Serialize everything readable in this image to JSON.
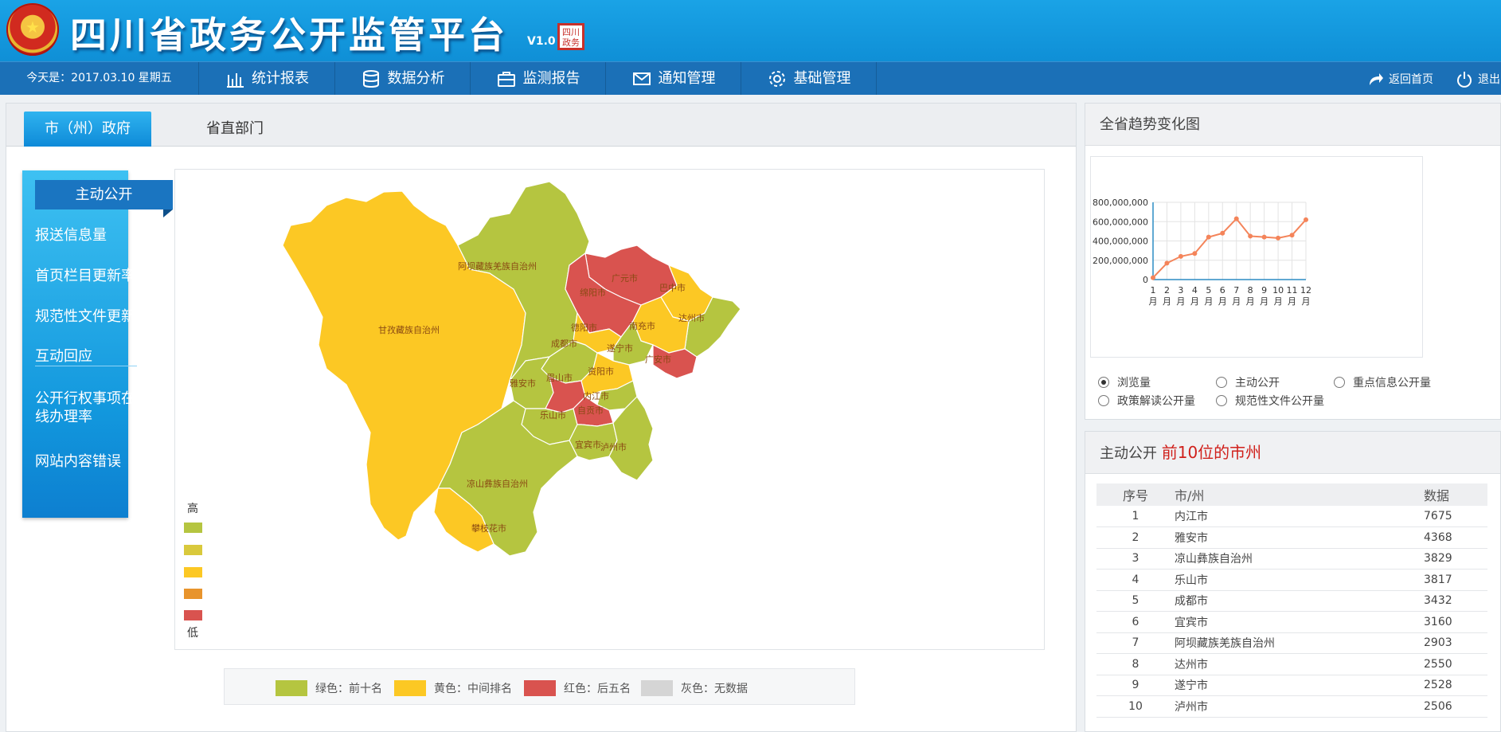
{
  "header": {
    "emblem_glyph": "★",
    "title": "四川省政务公开监管平台",
    "version": "V1.0",
    "seal_text": "四川政务"
  },
  "nav": {
    "date_text": "今天是：2017.03.10  星期五",
    "items": [
      {
        "label": "统计报表",
        "icon": "bar-chart-icon"
      },
      {
        "label": "数据分析",
        "icon": "database-icon"
      },
      {
        "label": "监测报告",
        "icon": "briefcase-icon"
      },
      {
        "label": "通知管理",
        "icon": "envelope-icon"
      },
      {
        "label": "基础管理",
        "icon": "gear-icon"
      }
    ],
    "home_label": "返回首页",
    "logout_label": "退出"
  },
  "tabs": {
    "active": "市（州）政府",
    "other": "省直部门"
  },
  "side_menu": {
    "head": "主动公开",
    "items": [
      "报送信息量",
      "首页栏目更新率",
      "规范性文件更新",
      "互动回应",
      "公开行权事项在线办理率",
      "网站内容错误"
    ]
  },
  "map": {
    "regions": [
      {
        "name": "甘孜藏族自治州",
        "level": "yellow"
      },
      {
        "name": "阿坝藏族羌族自治州",
        "level": "green"
      },
      {
        "name": "广元市",
        "level": "red"
      },
      {
        "name": "绵阳市",
        "level": "red"
      },
      {
        "name": "巴中市",
        "level": "yellow"
      },
      {
        "name": "达州市",
        "level": "green"
      },
      {
        "name": "南充市",
        "level": "yellow"
      },
      {
        "name": "德阳市",
        "level": "yellow"
      },
      {
        "name": "成都市",
        "level": "green"
      },
      {
        "name": "遂宁市",
        "level": "green"
      },
      {
        "name": "广安市",
        "level": "red"
      },
      {
        "name": "雅安市",
        "level": "green"
      },
      {
        "name": "眉山市",
        "level": "red"
      },
      {
        "name": "资阳市",
        "level": "yellow"
      },
      {
        "name": "内江市",
        "level": "green"
      },
      {
        "name": "乐山市",
        "level": "green"
      },
      {
        "name": "自贡市",
        "level": "red"
      },
      {
        "name": "宜宾市",
        "level": "green"
      },
      {
        "name": "泸州市",
        "level": "green"
      },
      {
        "name": "凉山彝族自治州",
        "level": "green"
      },
      {
        "name": "攀枝花市",
        "level": "yellow"
      }
    ],
    "scale_high": "高",
    "scale_low": "低",
    "scale_colors": [
      "#b5c540",
      "#d9c93c",
      "#fcc824",
      "#e8942c",
      "#d9534f"
    ]
  },
  "legend": [
    {
      "label": "绿色：前十名",
      "color": "#b5c540"
    },
    {
      "label": "黄色：中间排名",
      "color": "#fcc824"
    },
    {
      "label": "红色：后五名",
      "color": "#d9534f"
    },
    {
      "label": "灰色：无数据",
      "color": "#d5d5d5"
    }
  ],
  "trend": {
    "title": "全省趋势变化图",
    "options": [
      {
        "label": "浏览量",
        "checked": true
      },
      {
        "label": "主动公开",
        "checked": false
      },
      {
        "label": "重点信息公开量",
        "checked": false
      },
      {
        "label": "政策解读公开量",
        "checked": false
      },
      {
        "label": "规范性文件公开量",
        "checked": false
      }
    ]
  },
  "chart_data": {
    "type": "line",
    "categories": [
      "1月",
      "2月",
      "3月",
      "4月",
      "5月",
      "6月",
      "7月",
      "8月",
      "9月",
      "10月",
      "11月",
      "12月"
    ],
    "values": [
      20000000,
      170000000,
      240000000,
      270000000,
      440000000,
      480000000,
      630000000,
      450000000,
      440000000,
      430000000,
      460000000,
      620000000
    ],
    "yticks": [
      "800,000,000",
      "600,000,000",
      "400,000,000",
      "200,000,000",
      "0"
    ],
    "ylim": [
      0,
      800000000
    ],
    "line_color": "#f4845a",
    "grid": true
  },
  "ranking": {
    "title": "主动公开",
    "title_red": "前10位的市州",
    "headers": [
      "序号",
      "市/州",
      "数据"
    ],
    "rows": [
      [
        "1",
        "内江市",
        "7675"
      ],
      [
        "2",
        "雅安市",
        "4368"
      ],
      [
        "3",
        "凉山彝族自治州",
        "3829"
      ],
      [
        "4",
        "乐山市",
        "3817"
      ],
      [
        "5",
        "成都市",
        "3432"
      ],
      [
        "6",
        "宜宾市",
        "3160"
      ],
      [
        "7",
        "阿坝藏族羌族自治州",
        "2903"
      ],
      [
        "8",
        "达州市",
        "2550"
      ],
      [
        "9",
        "遂宁市",
        "2528"
      ],
      [
        "10",
        "泸州市",
        "2506"
      ]
    ]
  }
}
